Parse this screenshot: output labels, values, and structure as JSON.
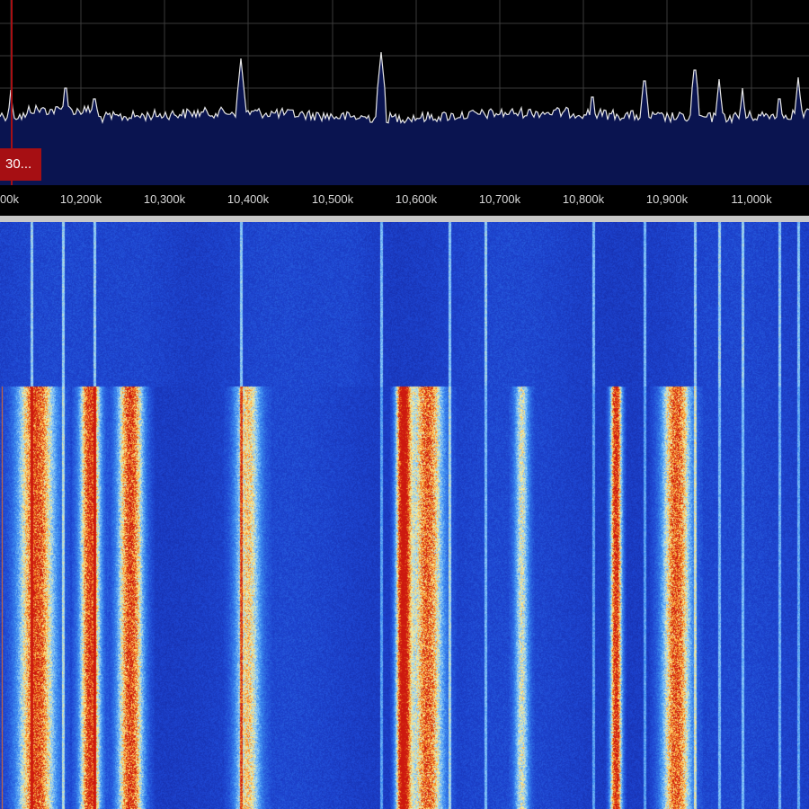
{
  "spectrum": {
    "tuner_offset_label": "30...",
    "freq_labels": [
      "00k",
      "10,200k",
      "10,300k",
      "10,400k",
      "10,500k",
      "10,600k",
      "10,700k",
      "10,800k",
      "10,900k",
      "11,000k"
    ]
  },
  "colors": {
    "background": "#000000",
    "spectrum_fill": "#0a1450",
    "spectrum_trace": "#e6e6e6",
    "tuner_marker": "#a60f13",
    "separator": "#c8c8c8",
    "waterfall_low": "#1c3cc8",
    "waterfall_mid": "#ffe070",
    "waterfall_high": "#d01810"
  }
}
